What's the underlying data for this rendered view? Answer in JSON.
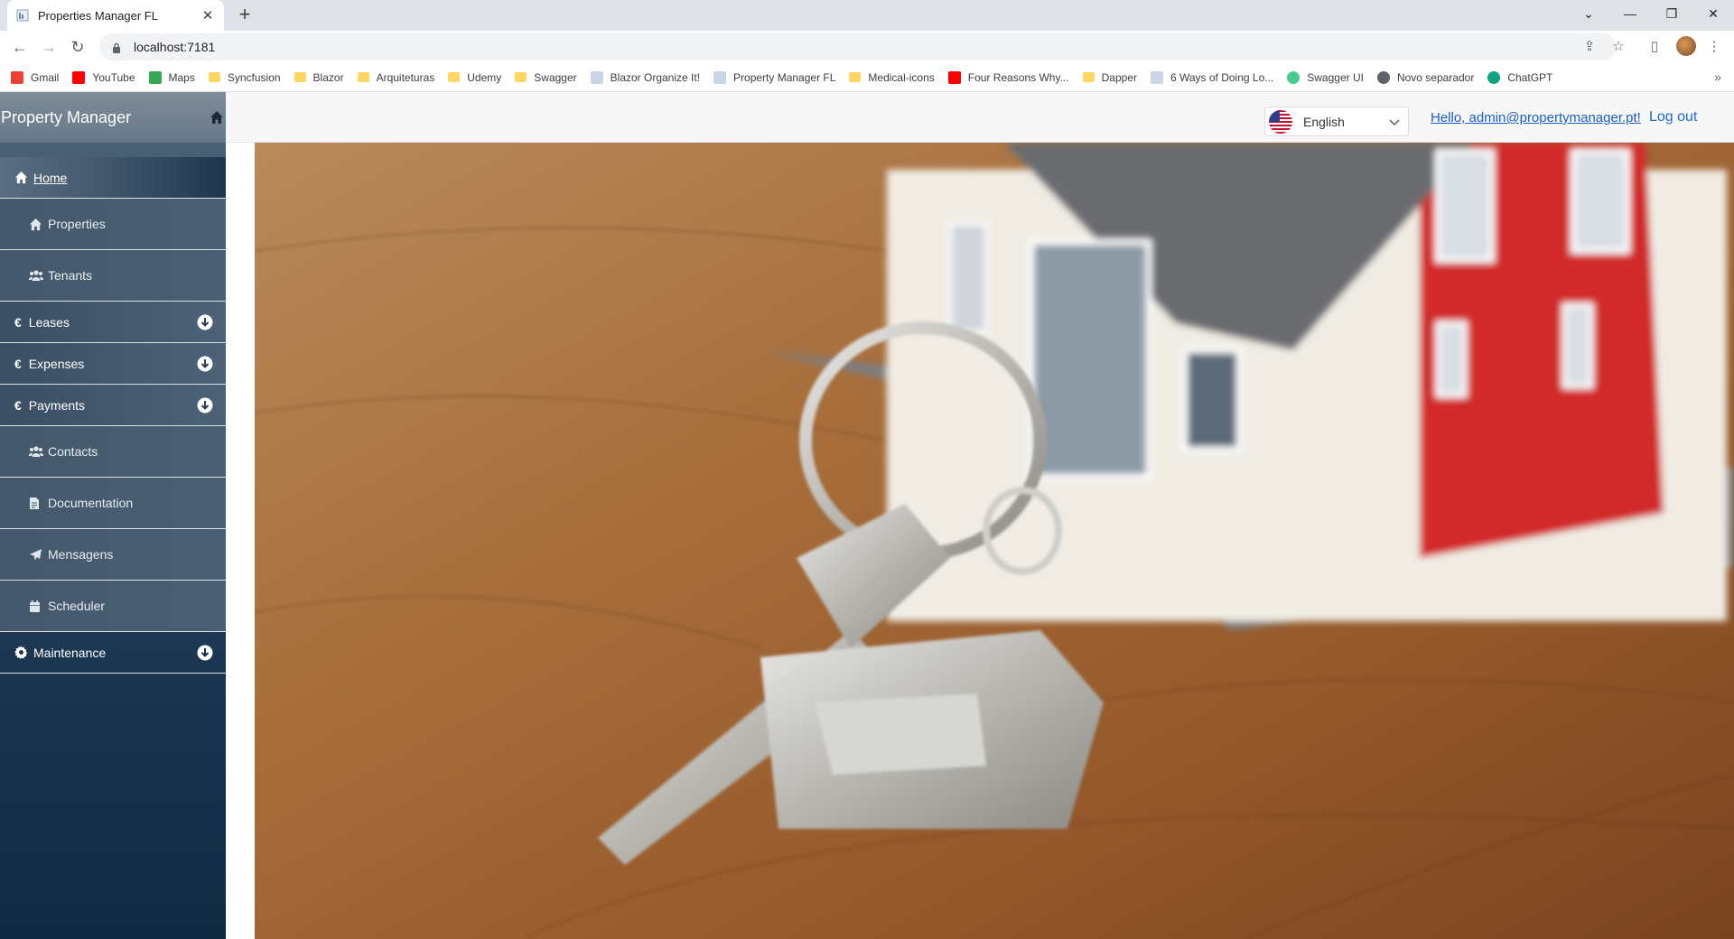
{
  "browser": {
    "tab_title": "Properties Manager FL",
    "url": "localhost:7181",
    "bookmarks": [
      {
        "label": "Gmail",
        "icon": "gmail-icon"
      },
      {
        "label": "YouTube",
        "icon": "youtube-icon"
      },
      {
        "label": "Maps",
        "icon": "maps-icon"
      },
      {
        "label": "Syncfusion",
        "icon": "folder-icon"
      },
      {
        "label": "Blazor",
        "icon": "folder-icon"
      },
      {
        "label": "Arquiteturas",
        "icon": "folder-icon"
      },
      {
        "label": "Udemy",
        "icon": "folder-icon"
      },
      {
        "label": "Swagger",
        "icon": "folder-icon"
      },
      {
        "label": "Blazor Organize It!",
        "icon": "page-icon"
      },
      {
        "label": "Property Manager FL",
        "icon": "page-icon"
      },
      {
        "label": "Medical-icons",
        "icon": "folder-icon"
      },
      {
        "label": "Four Reasons Why...",
        "icon": "youtube-icon"
      },
      {
        "label": "Dapper",
        "icon": "folder-icon"
      },
      {
        "label": "6 Ways of Doing Lo...",
        "icon": "page-icon"
      },
      {
        "label": "Swagger UI",
        "icon": "swagger-icon"
      },
      {
        "label": "Novo separador",
        "icon": "globe-icon"
      },
      {
        "label": "ChatGPT",
        "icon": "chatgpt-icon"
      }
    ],
    "more_bookmarks": "»"
  },
  "app": {
    "brand": "Property Manager",
    "nav": {
      "home": "Home",
      "properties": "Properties",
      "tenants": "Tenants",
      "leases": "Leases",
      "expenses": "Expenses",
      "payments": "Payments",
      "contacts": "Contacts",
      "documentation": "Documentation",
      "mensagens": "Mensagens",
      "scheduler": "Scheduler",
      "maintenance": "Maintenance",
      "currency_symbol": "€"
    },
    "topbar": {
      "language": "English",
      "greeting": "Hello, admin@propertymanager.pt!",
      "logout": "Log out"
    }
  },
  "colors": {
    "sidebar_dark": "#102a44",
    "sidebar_light": "#4e6478",
    "link": "#1a5fc4"
  }
}
